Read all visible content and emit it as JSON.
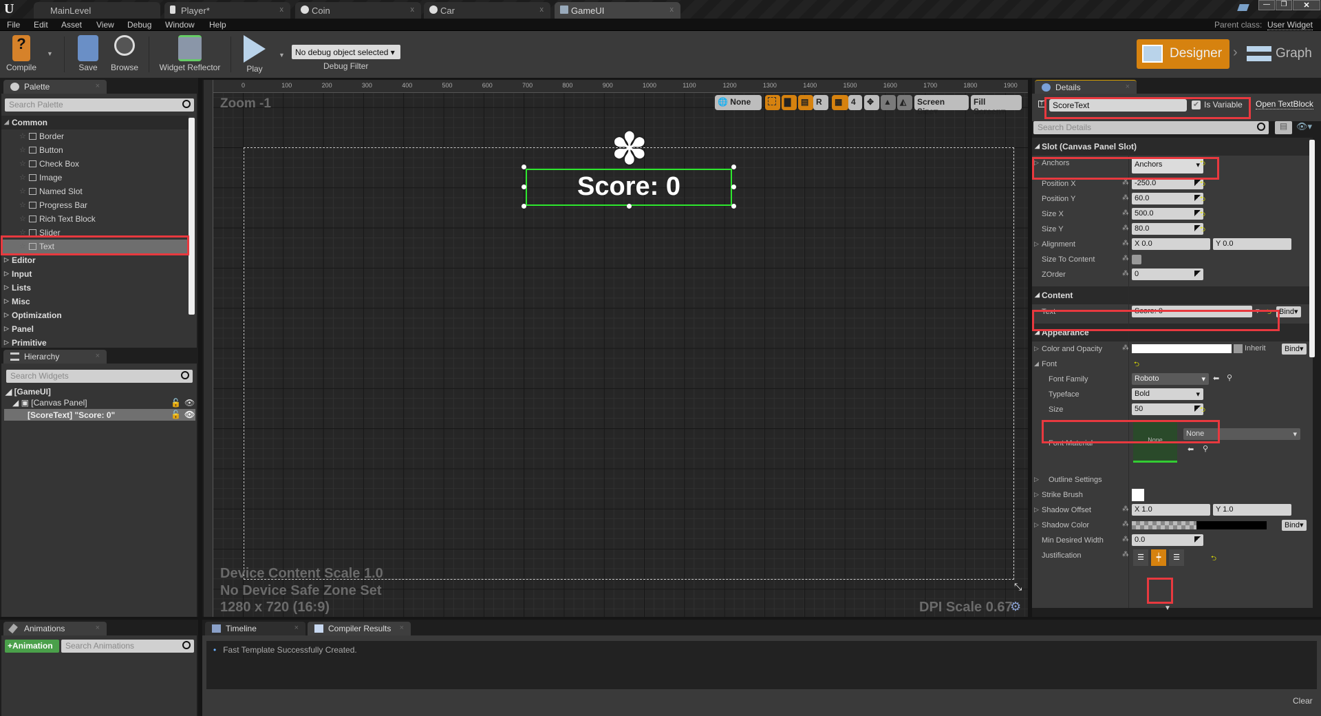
{
  "tabs": [
    {
      "label": "MainLevel",
      "icon": "level-icon"
    },
    {
      "label": "Player*",
      "icon": "blueprint-icon"
    },
    {
      "label": "Coin",
      "icon": "sphere-icon"
    },
    {
      "label": "Car",
      "icon": "sphere-icon"
    },
    {
      "label": "GameUI",
      "icon": "widget-blueprint-icon",
      "active": true
    }
  ],
  "menu": [
    "File",
    "Edit",
    "Asset",
    "View",
    "Debug",
    "Window",
    "Help"
  ],
  "parent_class": {
    "label": "Parent class:",
    "value": "User Widget"
  },
  "toolbar": {
    "compile": "Compile",
    "save": "Save",
    "browse": "Browse",
    "widget_reflector": "Widget Reflector",
    "play": "Play",
    "debug_select": "No debug object selected",
    "debug_filter": "Debug Filter"
  },
  "modes": {
    "designer": "Designer",
    "graph": "Graph",
    "accent": "#d6820f"
  },
  "palette": {
    "tab": "Palette",
    "search_placeholder": "Search Palette",
    "category": "Common",
    "items": [
      "Border",
      "Button",
      "Check Box",
      "Image",
      "Named Slot",
      "Progress Bar",
      "Rich Text Block",
      "Slider",
      "Text"
    ],
    "selected": "Text",
    "categories": [
      "Editor",
      "Input",
      "Lists",
      "Misc",
      "Optimization",
      "Panel",
      "Primitive"
    ]
  },
  "hierarchy": {
    "tab": "Hierarchy",
    "search_placeholder": "Search Widgets",
    "root": "[GameUI]",
    "canvas": "[Canvas Panel]",
    "selected": "[ScoreText] \"Score: 0\""
  },
  "canvas": {
    "zoom": "Zoom -1",
    "ruler_top": [
      "0",
      "100",
      "200",
      "300",
      "400",
      "500",
      "600",
      "700",
      "800",
      "900",
      "1000",
      "1100",
      "1200",
      "1300",
      "1400",
      "1500",
      "1600",
      "1700",
      "1800",
      "1900"
    ],
    "widget_text": "Score: 0",
    "device_scale": "Device Content Scale 1.0",
    "safe_zone": "No Device Safe Zone Set",
    "resolution": "1280 x 720 (16:9)",
    "dpi_scale": "DPI Scale 0.67",
    "toolbar": {
      "localization": "None",
      "snap": "4",
      "screen_size": "Screen Size",
      "fill_screen": "Fill Screen",
      "r": "R"
    }
  },
  "details": {
    "tab": "Details",
    "name": "ScoreText",
    "is_variable": "Is Variable",
    "is_variable_checked": true,
    "open": "Open TextBlock",
    "search_placeholder": "Search Details",
    "sections": [
      {
        "title": "Slot (Canvas Panel Slot)",
        "rows": [
          {
            "label": "Anchors",
            "expand": "right",
            "kind": "dropdown",
            "value": "Anchors",
            "reset": true
          },
          {
            "label": "Position X",
            "kind": "spin",
            "value": "-250.0",
            "reset": true,
            "ovr": true
          },
          {
            "label": "Position Y",
            "kind": "spin",
            "value": "60.0",
            "reset": true,
            "ovr": true
          },
          {
            "label": "Size X",
            "kind": "spin",
            "value": "500.0",
            "reset": true,
            "ovr": true
          },
          {
            "label": "Size Y",
            "kind": "spin",
            "value": "80.0",
            "reset": true,
            "ovr": true
          },
          {
            "label": "Alignment",
            "expand": "right",
            "kind": "xy",
            "x": "0.0",
            "y": "0.0",
            "ovr": true
          },
          {
            "label": "Size To Content",
            "kind": "check",
            "ovr": true
          },
          {
            "label": "ZOrder",
            "kind": "spin",
            "value": "0",
            "ovr": true
          }
        ]
      },
      {
        "title": "Content",
        "rows": [
          {
            "label": "Text",
            "kind": "text",
            "value": "Score: 0",
            "reset": true,
            "bind": "Bind"
          }
        ]
      },
      {
        "title": "Appearance",
        "rows": [
          {
            "label": "Color and Opacity",
            "expand": "right",
            "kind": "color",
            "inherit": "Inherit",
            "bind": "Bind",
            "ovr": true
          },
          {
            "label": "Font",
            "expand": "down",
            "kind": "none",
            "reset": true
          },
          {
            "label": "Font Family",
            "indent": true,
            "kind": "ddark",
            "value": "Roboto"
          },
          {
            "label": "Typeface",
            "indent": true,
            "kind": "dropdown",
            "value": "Bold"
          },
          {
            "label": "Size",
            "indent": true,
            "kind": "spin",
            "value": "50",
            "reset": true
          },
          {
            "label": "Font Material",
            "indent": true,
            "kind": "material",
            "thumb": "None",
            "value": "None"
          },
          {
            "label": "Outline Settings",
            "indent": true,
            "expand": "right",
            "kind": "none"
          },
          {
            "label": "Strike Brush",
            "expand": "right",
            "kind": "swatch"
          },
          {
            "label": "Shadow Offset",
            "expand": "right",
            "kind": "xy",
            "x": "1.0",
            "y": "1.0",
            "ovr": true
          },
          {
            "label": "Shadow Color",
            "expand": "right",
            "kind": "shadow",
            "bind": "Bind",
            "ovr": true
          },
          {
            "label": "Min Desired Width",
            "kind": "spin",
            "value": "0.0",
            "ovr": true
          },
          {
            "label": "Justification",
            "kind": "justify",
            "selected": "center",
            "reset": true,
            "ovr": true
          }
        ]
      }
    ]
  },
  "animations": {
    "tab": "Animations",
    "add": "+Animation",
    "search_placeholder": "Search Animations"
  },
  "bottom": {
    "tabs": [
      "Timeline",
      "Compiler Results"
    ],
    "active": "Compiler Results",
    "messages": [
      "Fast Template Successfully Created."
    ],
    "clear": "Clear"
  },
  "highlight_color": "#e8393f"
}
